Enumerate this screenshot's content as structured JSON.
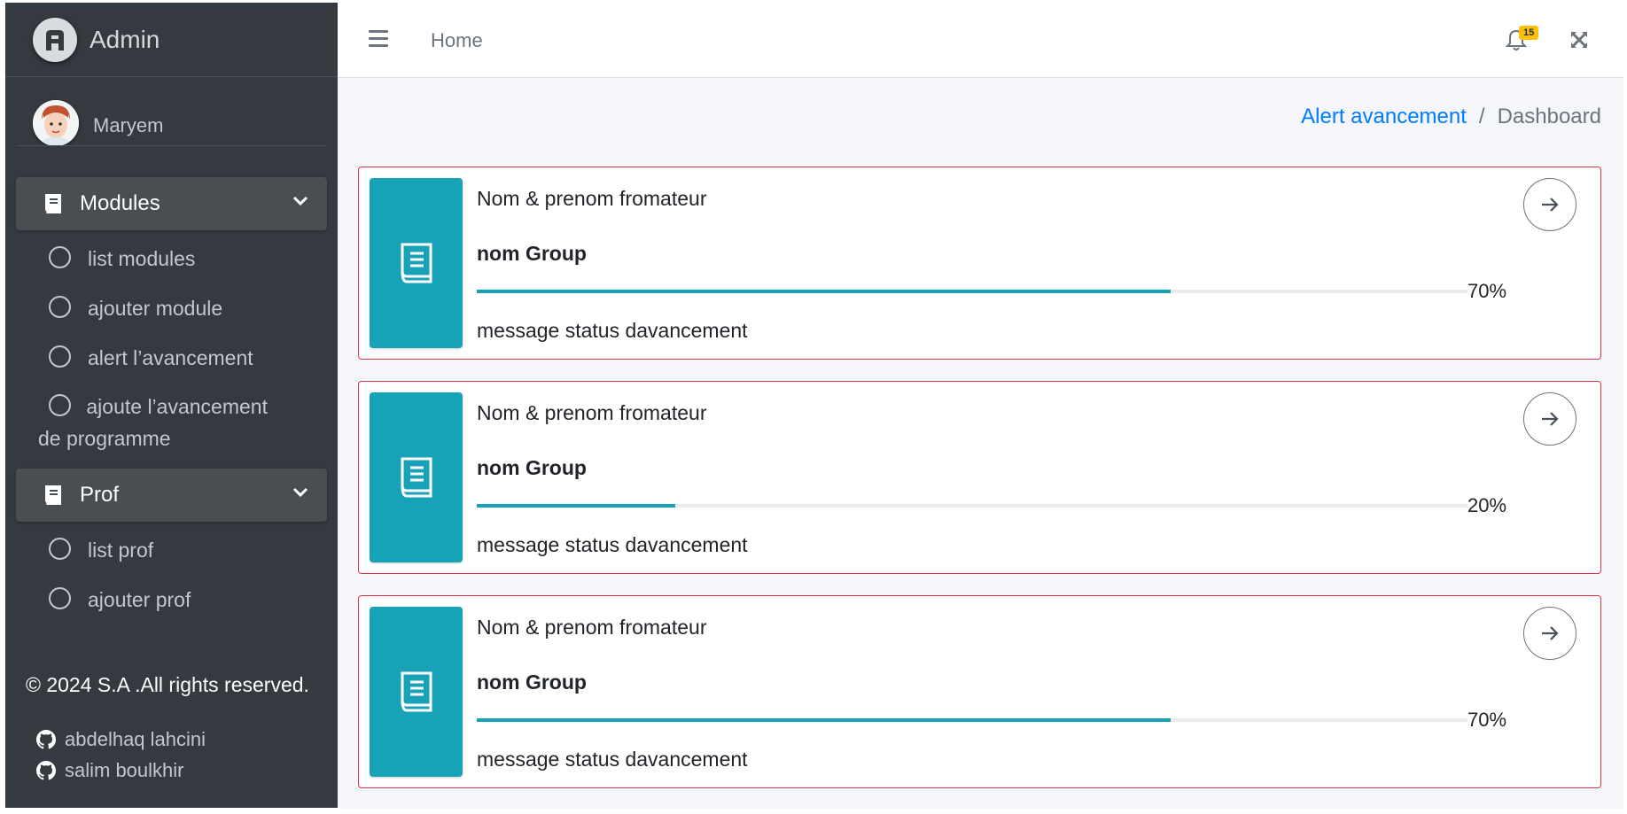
{
  "brand": {
    "name": "Admin",
    "logo_icon": "brand-logo-icon"
  },
  "user": {
    "name": "Maryem"
  },
  "sidebar": {
    "sections": [
      {
        "label": "Modules",
        "icon": "book-icon",
        "items": [
          "list modules",
          "ajouter module",
          "alert l’avancement",
          "ajoute l’avancement de programme"
        ]
      },
      {
        "label": "Prof",
        "icon": "book-icon",
        "items": [
          "list prof",
          "ajouter prof"
        ]
      }
    ],
    "footer": "© 2024 S.A .All rights reserved.",
    "credits": [
      "abdelhaq lahcini",
      "salim boulkhir"
    ]
  },
  "navbar": {
    "home": "Home",
    "notifications_count": "15"
  },
  "breadcrumb": {
    "link": "Alert avancement",
    "separator": "/",
    "active": "Dashboard"
  },
  "cards": [
    {
      "title": "Nom & prenom fromateur",
      "group": "nom Group",
      "progress": 0.7,
      "progress_label": "70%",
      "message": "message status davancement"
    },
    {
      "title": "Nom & prenom fromateur",
      "group": "nom Group",
      "progress": 0.2,
      "progress_label": "20%",
      "message": "message status davancement"
    },
    {
      "title": "Nom & prenom fromateur",
      "group": "nom Group",
      "progress": 0.7,
      "progress_label": "70%",
      "message": "message status davancement"
    }
  ],
  "colors": {
    "sidebar_bg": "#343a40",
    "accent": "#17a2b8",
    "card_border": "#dc3545",
    "link": "#007bff",
    "badge": "#ffc107"
  }
}
